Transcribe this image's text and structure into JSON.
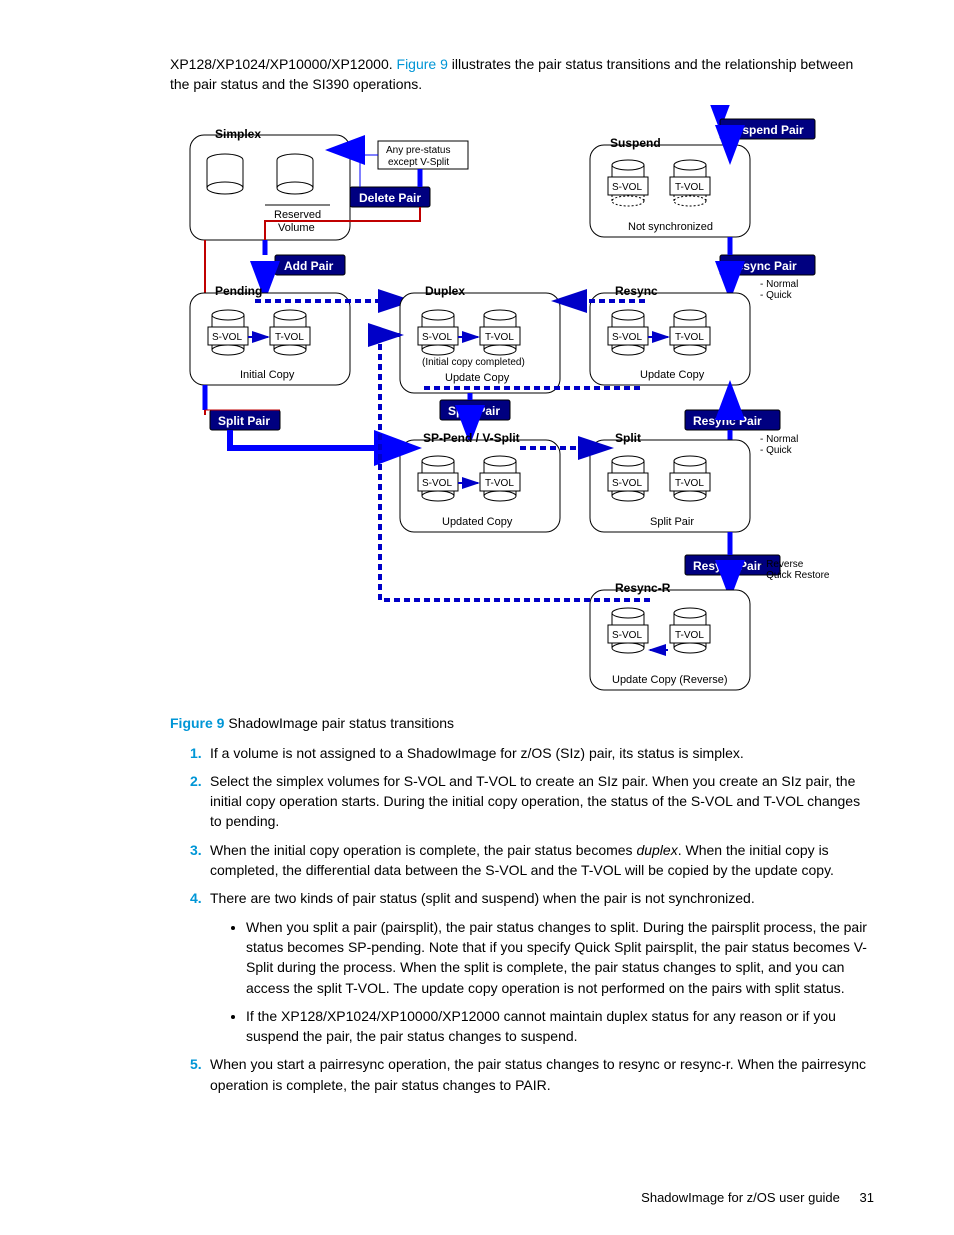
{
  "intro": {
    "prefix": "XP128/XP1024/XP10000/XP12000. ",
    "link": "Figure 9",
    "suffix": " illustrates the pair status transitions and the relationship between the pair status and the SI390 operations."
  },
  "figure": {
    "number": "Figure 9",
    "caption": " ShadowImage pair status transitions"
  },
  "diagram": {
    "buttons": {
      "suspend_pair": "Suspend Pair",
      "delete_pair": "Delete Pair",
      "add_pair": "Add Pair",
      "split_pair_left": "Split Pair",
      "split_pair_center": "Split Pair",
      "resync_pair_1": "Resync Pair",
      "resync_pair_2": "Resync Pair",
      "resync_pair_3": "Resync Pair"
    },
    "states": {
      "simplex": "Simplex",
      "suspend": "Suspend",
      "pending": "Pending",
      "duplex": "Duplex",
      "resync": "Resync",
      "sp_pend": "SP-Pend / V-Split",
      "split": "Split",
      "resync_r": "Resync-R"
    },
    "labels": {
      "any_pre_status": "Any pre-status",
      "except_vsplit": "except V-Split",
      "reserved": "Reserved",
      "volume": "Volume",
      "not_sync": "Not synchronized",
      "svol": "S-VOL",
      "tvol": "T-VOL",
      "initial_copy": "Initial Copy",
      "initial_copy_comp": "(Initial copy completed)",
      "update_copy": "Update Copy",
      "updated_copy": "Updated Copy",
      "split_pair_sub": "Split Pair",
      "update_copy_rev": "Update Copy (Reverse)",
      "normal": "- Normal",
      "quick": "- Quick",
      "reverse": "- Reverse",
      "quick_restore": "- Quick Restore"
    }
  },
  "steps": {
    "s1": "If a volume is not assigned to a ShadowImage for z/OS (SIz) pair, its status is simplex.",
    "s2": "Select the simplex volumes for S-VOL and T-VOL to create an SIz pair. When you create an SIz pair, the initial copy operation starts. During the initial copy operation, the status of the S-VOL and T-VOL changes to pending.",
    "s3a": "When the initial copy operation is complete, the pair status becomes ",
    "s3b": "duplex",
    "s3c": ". When the initial copy is completed, the differential data between the S-VOL and the T-VOL will be copied by the update copy.",
    "s4": "There are two kinds of pair status (split and suspend) when the pair is not synchronized.",
    "s4a": "When you split a pair (pairsplit), the pair status changes to split. During the pairsplit process, the pair status becomes SP-pending. Note that if you specify Quick Split pairsplit, the pair status becomes V-Split during the process. When the split is complete, the pair status changes to split, and you can access the split T-VOL. The update copy operation is not performed on the pairs with split status.",
    "s4b": "If the XP128/XP1024/XP10000/XP12000 cannot maintain duplex status for any reason or if you suspend the pair, the pair status changes to suspend.",
    "s5": "When you start a pairresync operation, the pair status changes to resync or resync-r. When the pairresync operation is complete, the pair status changes to PAIR."
  },
  "footer": {
    "title": "ShadowImage for z/OS user guide",
    "page": "31"
  }
}
